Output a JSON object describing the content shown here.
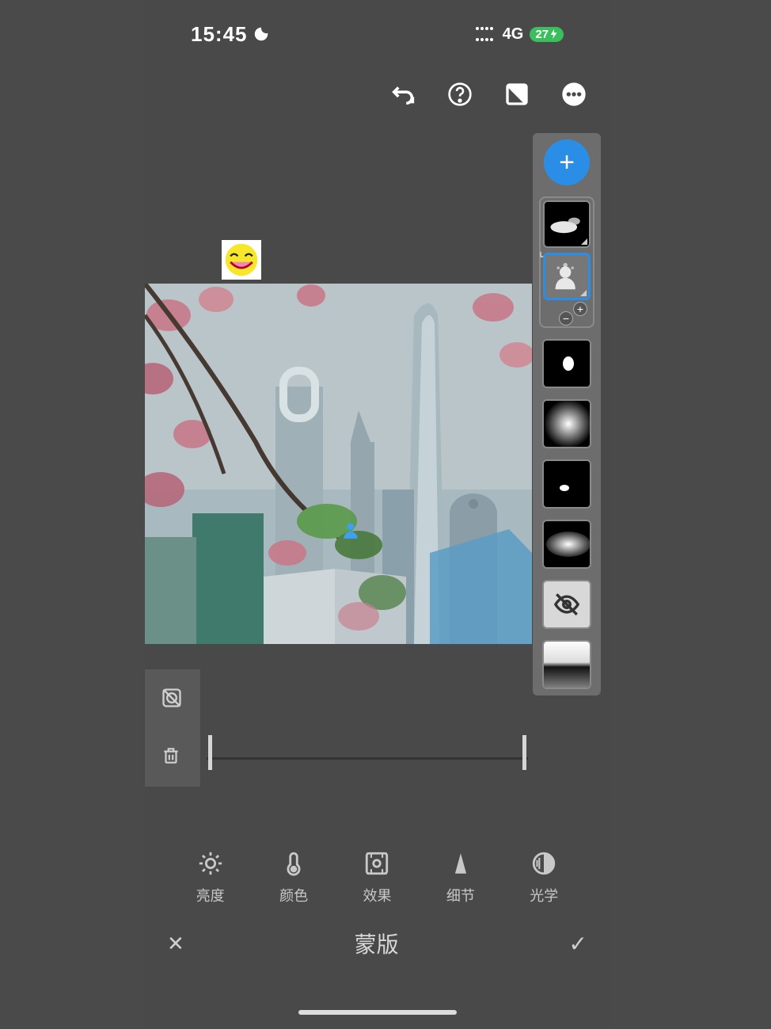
{
  "status": {
    "time": "15:45",
    "network": "4G",
    "battery": "27"
  },
  "top_actions": {
    "undo": "undo",
    "help": "help",
    "compare": "compare",
    "more": "more"
  },
  "layers": {
    "add": "+",
    "plus": "+",
    "minus": "−"
  },
  "adjustments": {
    "brightness": "亮度",
    "color": "颜色",
    "effect": "效果",
    "detail": "细节",
    "optics": "光学"
  },
  "bottom": {
    "title": "蒙版",
    "cancel": "✕",
    "confirm": "✓"
  }
}
